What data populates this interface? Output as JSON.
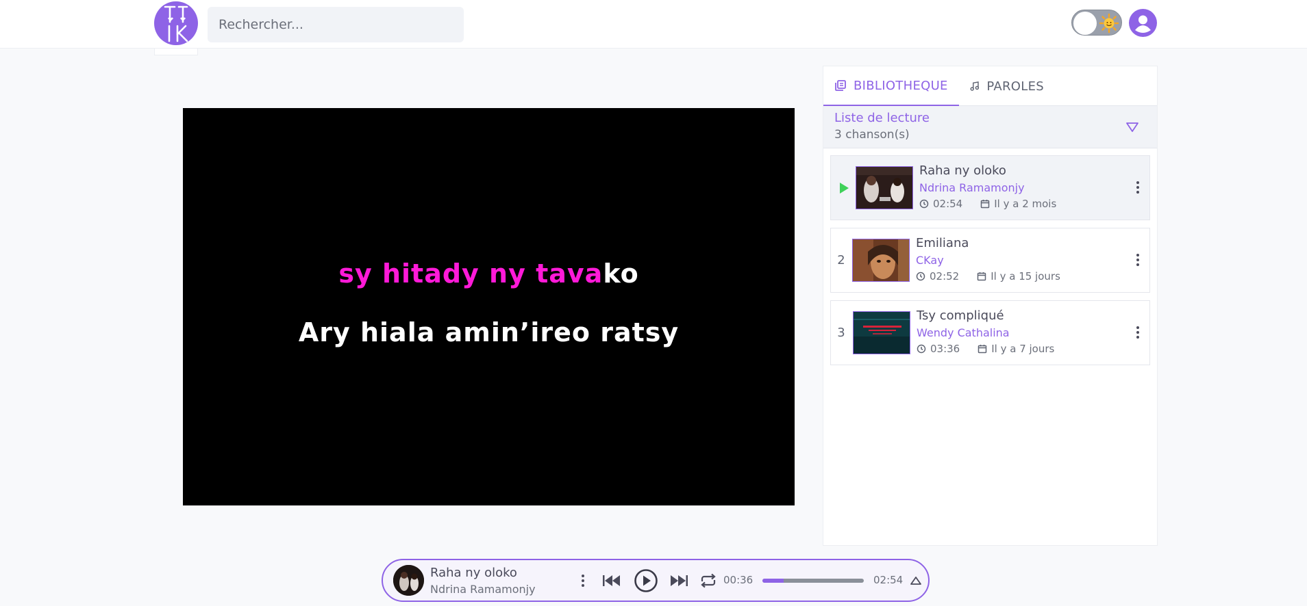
{
  "header": {
    "logo_text": "TIK",
    "search_placeholder": "Rechercher...",
    "theme_toggle_icon": "sun-icon",
    "avatar_icon": "user-icon"
  },
  "video": {
    "lyric_current_sung": "sy hitady ny tava",
    "lyric_current_unsung": "ko",
    "lyric_next": "Ary hiala amin’ireo ratsy"
  },
  "panel": {
    "tabs": [
      {
        "label": "BIBLIOTHEQUE",
        "icon": "library-icon",
        "active": true
      },
      {
        "label": "PAROLES",
        "icon": "music-note-icon",
        "active": false
      }
    ],
    "playlist": {
      "title": "Liste de lecture",
      "count": "3 chanson(s)"
    },
    "songs": [
      {
        "index": "",
        "playing": true,
        "title": "Raha ny oloko",
        "artist": "Ndrina Ramamonjy",
        "duration": "02:54",
        "date": "Il y a 2 mois"
      },
      {
        "index": "2",
        "playing": false,
        "title": "Emiliana",
        "artist": "CKay",
        "duration": "02:52",
        "date": "Il y a 15 jours"
      },
      {
        "index": "3",
        "playing": false,
        "title": "Tsy compliqué",
        "artist": "Wendy Cathalina",
        "duration": "03:36",
        "date": "Il y a 7 jours"
      }
    ]
  },
  "player": {
    "title": "Raha ny oloko",
    "artist": "Ndrina Ramamonjy",
    "current_time": "00:36",
    "total_time": "02:54",
    "progress": 0.21
  },
  "colors": {
    "accent": "#8e63e6",
    "lyric_highlight": "#ff1ad8",
    "play_indicator": "#3fd15a"
  }
}
